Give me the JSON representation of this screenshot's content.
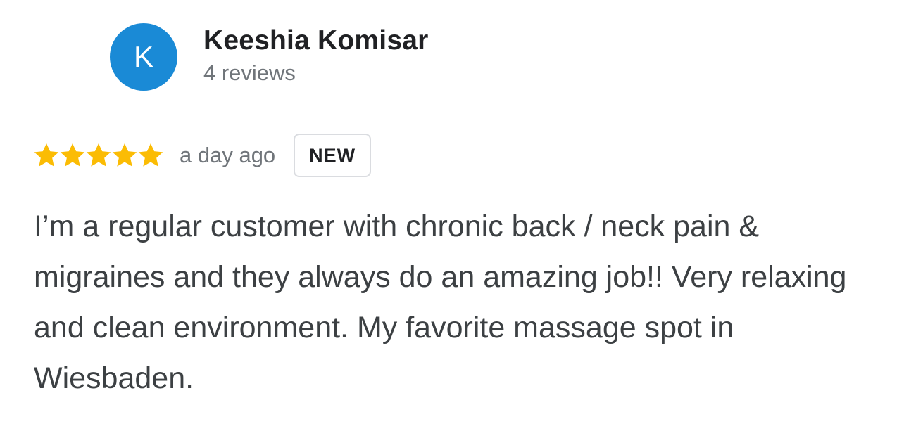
{
  "reviewer": {
    "initial": "K",
    "avatar_color": "#1a8ad6",
    "name": "Keeshia Komisar",
    "review_count": "4 reviews"
  },
  "rating": {
    "value": 5,
    "max": 5,
    "star_color": "#fbbc04",
    "star_icon": "star-icon",
    "time": "a day ago",
    "badge": "NEW"
  },
  "review": {
    "text": "I’m a regular customer with chronic back / neck pain & migraines and they always do an amazing job!! Very relaxing and clean environment. My favorite massage spot in Wiesbaden."
  }
}
